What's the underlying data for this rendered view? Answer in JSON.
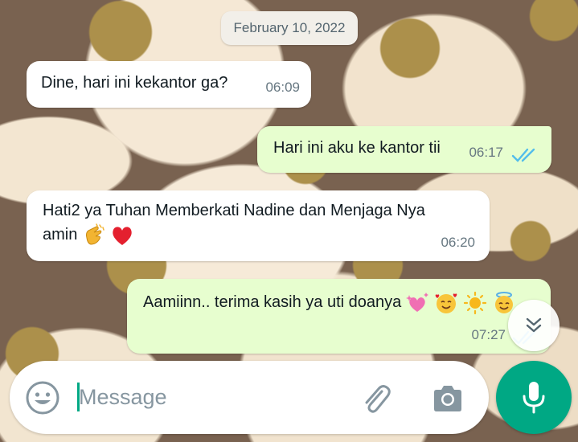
{
  "chat": {
    "date_separator": "February 10, 2022",
    "messages": [
      {
        "direction": "incoming",
        "text": "Dine, hari ini kekantor ga?",
        "time": "06:09"
      },
      {
        "direction": "outgoing",
        "text": "Hari ini aku ke kantor tii",
        "time": "06:17",
        "status": "read"
      },
      {
        "direction": "incoming",
        "text_line1": "Hati2 ya Tuhan Memberkati Nadine dan Menjaga Nya",
        "text_line2": "amin",
        "emojis": [
          "clapping-hands",
          "red-heart"
        ],
        "time": "06:20"
      },
      {
        "direction": "outgoing",
        "text": "Aamiinn.. terima kasih ya uti doanya",
        "emojis": [
          "sparkling-hearts",
          "smiling-face-with-hearts",
          "sun",
          "smiling-face-with-halo"
        ],
        "time": "07:27",
        "status": "read"
      }
    ]
  },
  "composer": {
    "placeholder": "Message",
    "icons": {
      "emoji": "emoji-icon",
      "attach": "paperclip-icon",
      "camera": "camera-icon",
      "mic": "mic-icon",
      "scroll": "double-chevron-down-icon"
    }
  },
  "colors": {
    "accent": "#00a884",
    "outgoing_bubble": "#e7fecf",
    "incoming_bubble": "#ffffff",
    "read_ticks": "#53bdeb",
    "timestamp": "#667781"
  }
}
